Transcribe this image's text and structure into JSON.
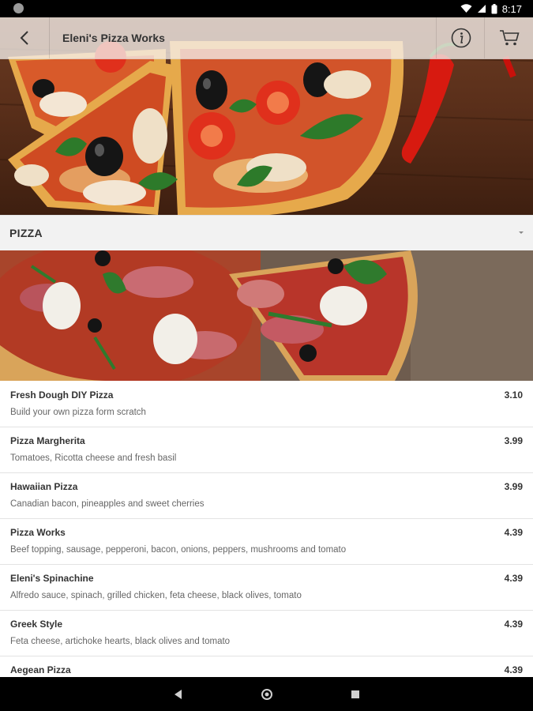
{
  "status_bar": {
    "time": "8:17"
  },
  "app_bar": {
    "title": "Eleni's Pizza Works"
  },
  "category": {
    "label": "PIZZA"
  },
  "menu_items": [
    {
      "name": "Fresh Dough DIY Pizza",
      "description": "Build your own pizza form scratch",
      "price": "3.10"
    },
    {
      "name": "Pizza Margherita",
      "description": "Tomatoes, Ricotta cheese and fresh basil",
      "price": "3.99"
    },
    {
      "name": "Hawaiian Pizza",
      "description": "Canadian bacon, pineapples and sweet cherries",
      "price": "3.99"
    },
    {
      "name": "Pizza Works",
      "description": "Beef topping, sausage, pepperoni, bacon, onions, peppers, mushrooms and tomato",
      "price": "4.39"
    },
    {
      "name": "Eleni's Spinachine",
      "description": "Alfredo sauce, spinach, grilled chicken, feta cheese, black olives, tomato",
      "price": "4.39"
    },
    {
      "name": "Greek Style",
      "description": "Feta cheese, artichoke hearts, black olives and tomato",
      "price": "4.39"
    },
    {
      "name": "Aegean Pizza",
      "description": "",
      "price": "4.39"
    }
  ],
  "icons": {
    "back": "arrow-back-icon",
    "info": "info-icon",
    "cart": "cart-icon",
    "nav_back": "nav-back-icon",
    "nav_home": "nav-home-icon",
    "nav_recents": "nav-recents-icon"
  },
  "colors": {
    "accent_dark": "#333333",
    "divider": "#e3e3e3",
    "category_bg": "#f2f2f2"
  }
}
